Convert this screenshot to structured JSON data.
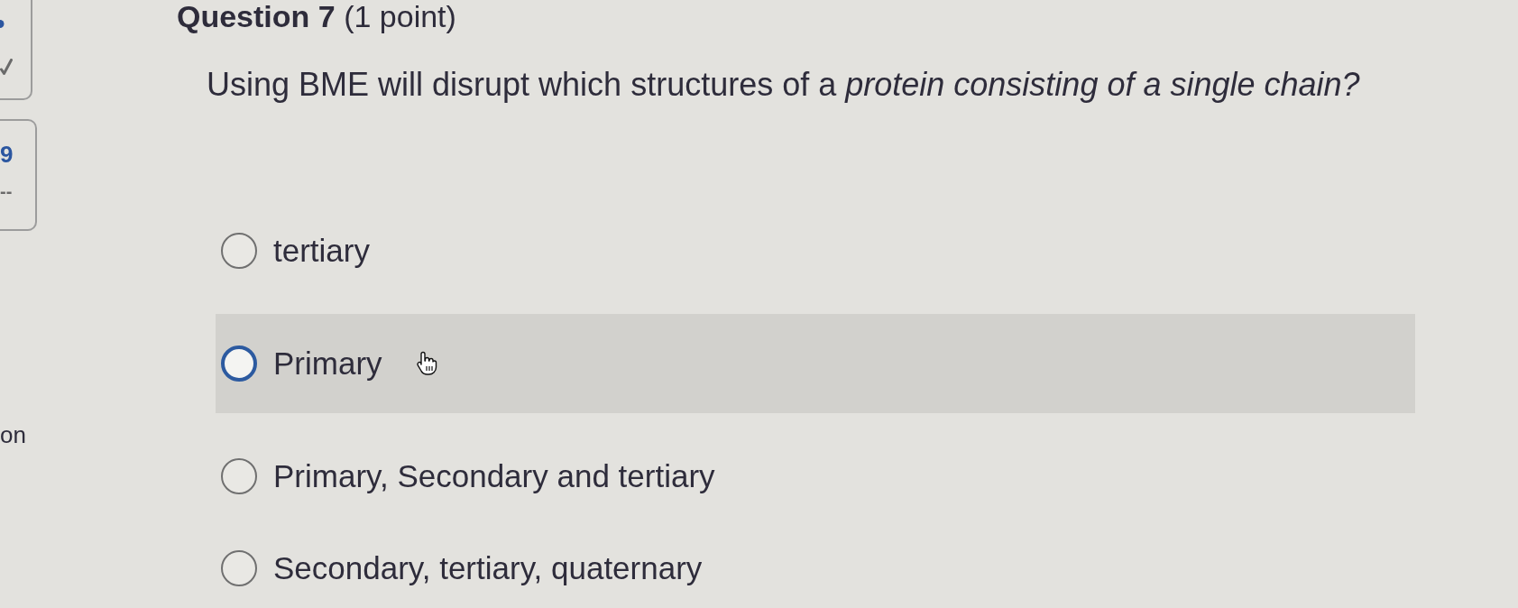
{
  "question_nav": [
    {
      "kind": "answered"
    },
    {
      "kind": "unanswered",
      "number": "9",
      "points": "--"
    }
  ],
  "nav_label": "on",
  "heading": "**Question 7** (1 point)",
  "question": "Using BME will disrupt which structures of a *protein consisting of a single chain?*",
  "options": [
    {
      "label": "tertiary",
      "selected": false,
      "hovered": false
    },
    {
      "label": "Primary",
      "selected": false,
      "hovered": true
    },
    {
      "label": "Primary, Secondary and tertiary",
      "selected": false,
      "hovered": false
    },
    {
      "label": "Secondary, tertiary, quaternary",
      "selected": false,
      "hovered": false
    }
  ]
}
